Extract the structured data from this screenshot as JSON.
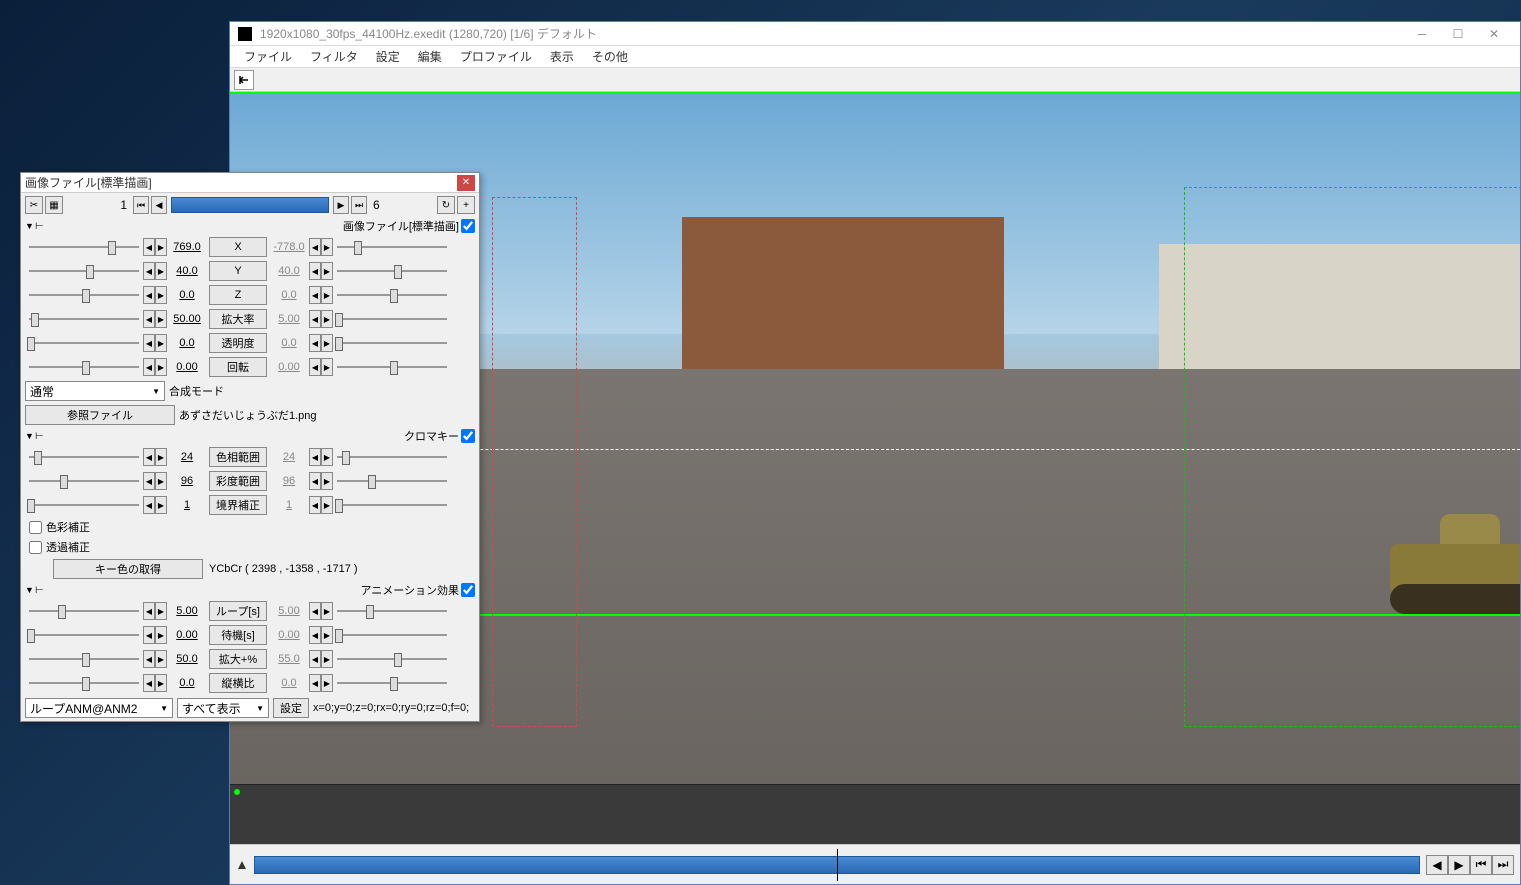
{
  "window": {
    "title": "1920x1080_30fps_44100Hz.exedit (1280,720)  [1/6]  デフォルト"
  },
  "menu": {
    "file": "ファイル",
    "filter": "フィルタ",
    "settings": "設定",
    "edit": "編集",
    "profile": "プロファイル",
    "view": "表示",
    "other": "その他"
  },
  "panel": {
    "title": "画像ファイル[標準描画]",
    "frame_start": "1",
    "frame_end": "6",
    "sections": {
      "standard": {
        "label": "画像ファイル[標準描画]"
      },
      "chroma": {
        "label": "クロマキー"
      },
      "anim": {
        "label": "アニメーション効果"
      }
    },
    "params": {
      "x": {
        "label": "X",
        "left": "769.0",
        "right": "-778.0"
      },
      "y": {
        "label": "Y",
        "left": "40.0",
        "right": "40.0"
      },
      "z": {
        "label": "Z",
        "left": "0.0",
        "right": "0.0"
      },
      "scale": {
        "label": "拡大率",
        "left": "50.00",
        "right": "5.00"
      },
      "alpha": {
        "label": "透明度",
        "left": "0.0",
        "right": "0.0"
      },
      "rot": {
        "label": "回転",
        "left": "0.00",
        "right": "0.00"
      },
      "hue": {
        "label": "色相範囲",
        "left": "24",
        "right": "24"
      },
      "sat": {
        "label": "彩度範囲",
        "left": "96",
        "right": "96"
      },
      "edge": {
        "label": "境界補正",
        "left": "1",
        "right": "1"
      },
      "loop": {
        "label": "ループ[s]",
        "left": "5.00",
        "right": "5.00"
      },
      "wait": {
        "label": "待機[s]",
        "left": "0.00",
        "right": "0.00"
      },
      "growp": {
        "label": "拡大+%",
        "left": "50.0",
        "right": "55.0"
      },
      "aspect": {
        "label": "縦横比",
        "left": "0.0",
        "right": "0.0"
      }
    },
    "blend": {
      "label": "合成モード",
      "value": "通常"
    },
    "ref_file": {
      "btn": "参照ファイル",
      "text": "あずさだいじょうぶだ1.png"
    },
    "color_correct": "色彩補正",
    "trans_correct": "透過補正",
    "key_color": {
      "btn": "キー色の取得",
      "text": "YCbCr ( 2398 , -1358 , -1717 )"
    },
    "anim_combo1": "ループANM@ANM2",
    "anim_combo2": "すべて表示",
    "anim_settings_btn": "設定",
    "anim_settings_text": "x=0;y=0;z=0;rx=0;ry=0;rz=0;f=0;"
  }
}
